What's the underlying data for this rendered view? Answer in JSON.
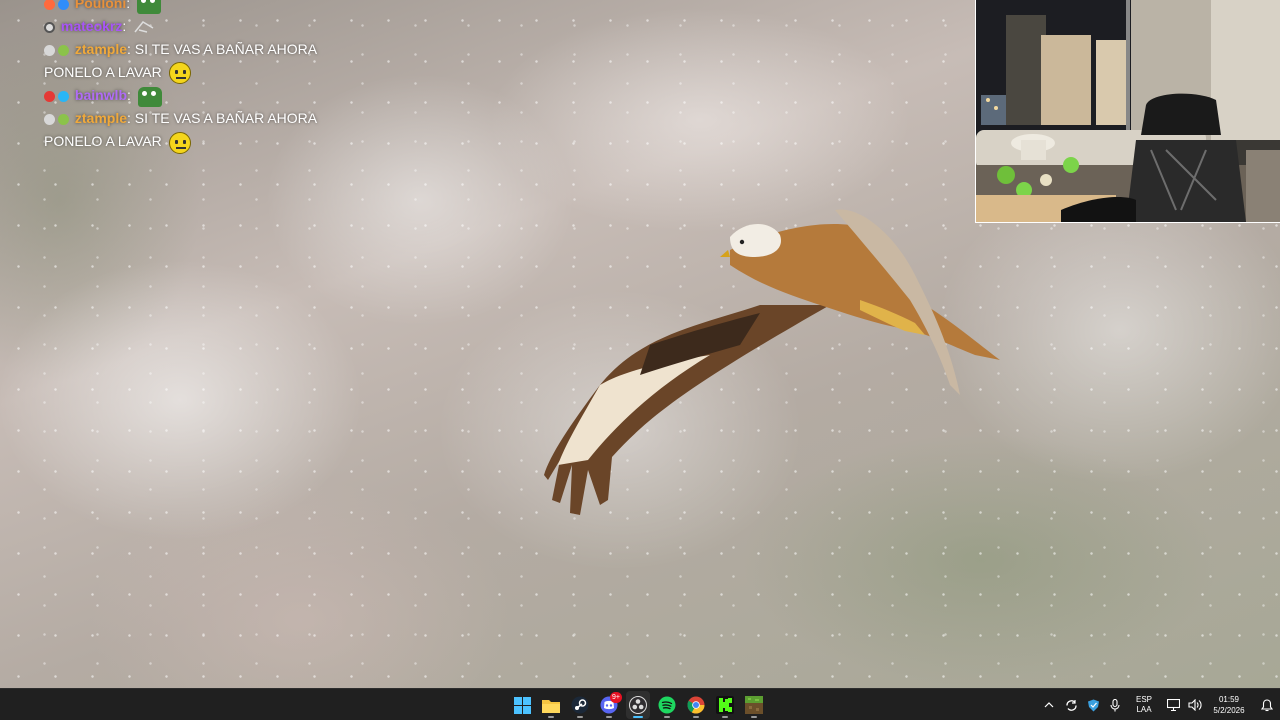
{
  "chat": {
    "messages": [
      {
        "user": "Pouloni",
        "text": "",
        "emote": "frog-emote",
        "user_color": "#e8913b",
        "badges": [
          "#ff6a3d",
          "#2f8dfa"
        ]
      },
      {
        "user": "mateokrz",
        "text": "",
        "emote": "sketch-emote",
        "user_color": "#a855f7",
        "badges": [
          "#dcdcdc"
        ]
      },
      {
        "user": "ztample",
        "text": "SI TE VAS A BAÑAR AHORA PONELO A LAVAR",
        "emote": "neutral-face-emote",
        "user_color": "#f0a93b",
        "badges": [
          "#d8d8d8",
          "#8bc34a"
        ]
      },
      {
        "user": "bainwlb",
        "text": "",
        "emote": "frog-emote",
        "user_color": "#b06cf5",
        "badges": [
          "#e53935",
          "#29b6f6"
        ]
      },
      {
        "user": "ztample",
        "text": "SI TE VAS A BAÑAR AHORA PONELO A LAVAR",
        "emote": "neutral-face-emote",
        "user_color": "#f0a93b",
        "badges": [
          "#d8d8d8",
          "#8bc34a"
        ]
      }
    ]
  },
  "taskbar": {
    "apps": [
      {
        "name": "start-button",
        "icon": "windows-logo-icon"
      },
      {
        "name": "file-explorer",
        "icon": "folder-icon"
      },
      {
        "name": "steam",
        "icon": "steam-icon"
      },
      {
        "name": "discord",
        "icon": "discord-icon",
        "badge": "9+"
      },
      {
        "name": "obs",
        "icon": "obs-icon",
        "active": true
      },
      {
        "name": "spotify",
        "icon": "spotify-icon"
      },
      {
        "name": "chrome",
        "icon": "chrome-icon"
      },
      {
        "name": "kick",
        "icon": "kick-icon"
      },
      {
        "name": "minecraft",
        "icon": "minecraft-icon"
      }
    ],
    "tray": {
      "lang_line1": "ESP",
      "lang_line2": "LAA",
      "time": "01:59",
      "date": "5/2/2026"
    }
  }
}
